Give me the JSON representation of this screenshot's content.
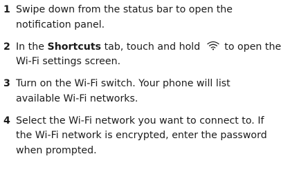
{
  "steps": [
    {
      "number": "1",
      "lines": [
        "Swipe down from the status bar to open the",
        "notification panel."
      ]
    },
    {
      "number": "2",
      "pre": "In the ",
      "bold": "Shortcuts",
      "mid": " tab, touch and hold ",
      "icon": "wifi-icon",
      "post": " to open the",
      "line2": "Wi-Fi settings screen."
    },
    {
      "number": "3",
      "lines": [
        "Turn on the Wi-Fi switch. Your phone will list",
        "available Wi-Fi networks."
      ]
    },
    {
      "number": "4",
      "lines": [
        "Select the Wi-Fi network you want to connect to. If",
        "the Wi-Fi network is encrypted, enter the password",
        "when prompted."
      ]
    }
  ]
}
